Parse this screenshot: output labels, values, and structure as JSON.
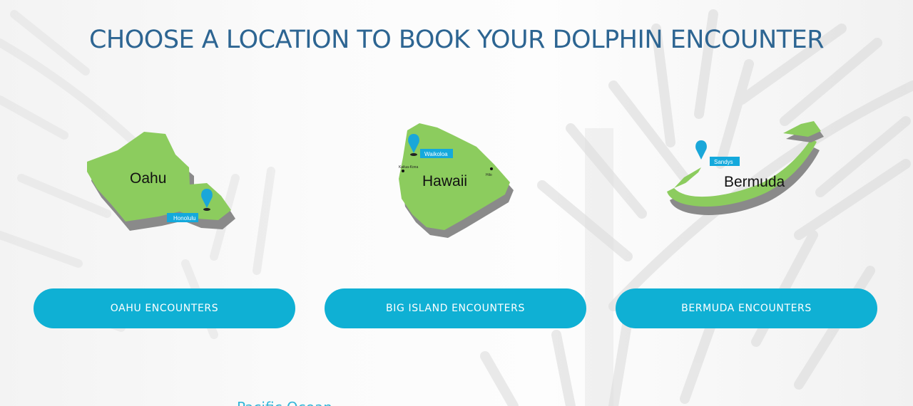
{
  "page": {
    "headline": "CHOOSE A LOCATION TO BOOK YOUR DOLPHIN ENCOUNTER",
    "partial_footer_text": "Pacific Ocean"
  },
  "colors": {
    "headline": "#2d6592",
    "button": "#0fb0d4",
    "button_text": "#ffffff",
    "island_fill": "#8ccc5e",
    "island_shadow": "#8a8a8a",
    "pin": "#1aa7d9",
    "pin_tag": "#14a9dc"
  },
  "locations": [
    {
      "island_name": "Oahu",
      "pin_city": "Honolulu",
      "button_label": "OAHU ENCOUNTERS"
    },
    {
      "island_name": "Hawaii",
      "pin_city": "Waikoloa",
      "other_towns": [
        "Kailua-Kona",
        "Hilo"
      ],
      "button_label": "BIG ISLAND ENCOUNTERS"
    },
    {
      "island_name": "Bermuda",
      "pin_city": "Sandys",
      "button_label": "BERMUDA ENCOUNTERS"
    }
  ],
  "icons": {
    "location_pin": "map-pin-icon",
    "town_marker": "town-dot-icon"
  }
}
